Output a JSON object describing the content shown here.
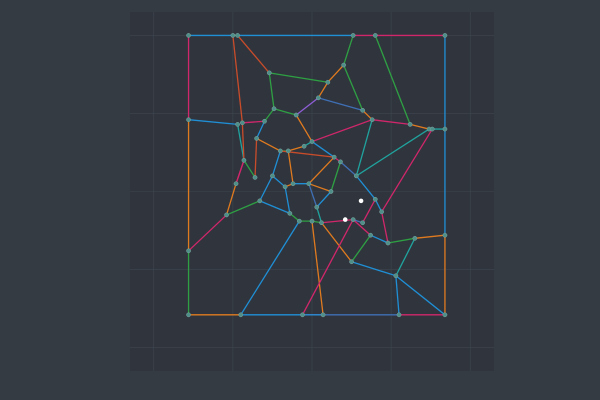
{
  "colors": {
    "figure_bg": "#353b43",
    "plot_bg": "#30353d",
    "grid": "#3f464f",
    "node_fill": "#4f8f8a",
    "node_stroke": "#7fa7a3",
    "highlight_node": "#ffffff",
    "palette": [
      "#1f8fd6",
      "#e07a1f",
      "#2ea043",
      "#d1266b",
      "#8e5ed6",
      "#20a39e",
      "#c94c2a",
      "#3f6fb5"
    ]
  },
  "chart_data": {
    "type": "scatter",
    "xlim": [
      -1.15,
      1.15
    ],
    "ylim": [
      -1.15,
      1.15
    ],
    "grid": true,
    "legend": "none",
    "nodes": [
      [
        -0.78,
        1.0
      ],
      [
        -0.5,
        1.0
      ],
      [
        -0.47,
        1.0
      ],
      [
        0.26,
        1.0
      ],
      [
        0.4,
        1.0
      ],
      [
        0.84,
        1.0
      ],
      [
        -0.78,
        0.46
      ],
      [
        -0.47,
        0.43
      ],
      [
        -0.44,
        0.44
      ],
      [
        -0.27,
        0.76
      ],
      [
        0.1,
        0.7
      ],
      [
        0.2,
        0.81
      ],
      [
        0.04,
        0.6
      ],
      [
        -0.24,
        0.53
      ],
      [
        -0.1,
        0.49
      ],
      [
        0.32,
        0.52
      ],
      [
        0.38,
        0.46
      ],
      [
        0.62,
        0.43
      ],
      [
        0.74,
        0.4
      ],
      [
        0.76,
        0.4
      ],
      [
        0.84,
        0.4
      ],
      [
        0.0,
        0.32
      ],
      [
        -0.3,
        0.45
      ],
      [
        -0.35,
        0.34
      ],
      [
        -0.2,
        0.26
      ],
      [
        -0.15,
        0.26
      ],
      [
        -0.05,
        0.29
      ],
      [
        -0.43,
        0.2
      ],
      [
        -0.48,
        0.05
      ],
      [
        -0.36,
        0.09
      ],
      [
        -0.25,
        0.1
      ],
      [
        -0.17,
        0.03
      ],
      [
        -0.12,
        0.05
      ],
      [
        -0.02,
        0.05
      ],
      [
        0.14,
        0.22
      ],
      [
        0.18,
        0.19
      ],
      [
        0.28,
        0.1
      ],
      [
        0.4,
        -0.05
      ],
      [
        0.44,
        -0.13
      ],
      [
        -0.54,
        -0.15
      ],
      [
        -0.78,
        -0.38
      ],
      [
        -0.33,
        -0.06
      ],
      [
        -0.14,
        -0.14
      ],
      [
        -0.08,
        -0.19
      ],
      [
        0.0,
        -0.19
      ],
      [
        0.06,
        -0.2
      ],
      [
        0.03,
        -0.1
      ],
      [
        0.12,
        0.0
      ],
      [
        0.32,
        -0.2
      ],
      [
        0.26,
        -0.18
      ],
      [
        0.48,
        -0.33
      ],
      [
        0.37,
        -0.28
      ],
      [
        0.65,
        -0.3
      ],
      [
        0.84,
        -0.28
      ],
      [
        0.25,
        -0.45
      ],
      [
        0.53,
        -0.54
      ],
      [
        0.84,
        -0.79
      ],
      [
        0.55,
        -0.79
      ],
      [
        0.07,
        -0.79
      ],
      [
        -0.06,
        -0.79
      ],
      [
        -0.45,
        -0.79
      ],
      [
        -0.78,
        -0.79
      ]
    ],
    "highlight_points": [
      [
        0.21,
        -0.18
      ],
      [
        0.31,
        -0.06
      ]
    ],
    "edges": [
      [
        0,
        1,
        0
      ],
      [
        0,
        6,
        3
      ],
      [
        1,
        2,
        2
      ],
      [
        2,
        3,
        0
      ],
      [
        3,
        4,
        3
      ],
      [
        4,
        5,
        3
      ],
      [
        5,
        20,
        0
      ],
      [
        6,
        40,
        1
      ],
      [
        6,
        7,
        0
      ],
      [
        1,
        8,
        6
      ],
      [
        2,
        9,
        6
      ],
      [
        9,
        10,
        2
      ],
      [
        3,
        11,
        2
      ],
      [
        11,
        10,
        1
      ],
      [
        10,
        12,
        1
      ],
      [
        12,
        14,
        4
      ],
      [
        9,
        13,
        2
      ],
      [
        13,
        14,
        2
      ],
      [
        11,
        15,
        2
      ],
      [
        12,
        15,
        7
      ],
      [
        15,
        16,
        1
      ],
      [
        4,
        17,
        2
      ],
      [
        16,
        17,
        3
      ],
      [
        17,
        18,
        1
      ],
      [
        18,
        19,
        5
      ],
      [
        19,
        20,
        5
      ],
      [
        16,
        21,
        3
      ],
      [
        14,
        21,
        1
      ],
      [
        8,
        22,
        3
      ],
      [
        22,
        13,
        2
      ],
      [
        22,
        23,
        0
      ],
      [
        23,
        24,
        1
      ],
      [
        24,
        25,
        2
      ],
      [
        25,
        26,
        1
      ],
      [
        26,
        21,
        5
      ],
      [
        7,
        27,
        5
      ],
      [
        8,
        27,
        6
      ],
      [
        27,
        28,
        3
      ],
      [
        23,
        29,
        6
      ],
      [
        29,
        27,
        2
      ],
      [
        24,
        30,
        0
      ],
      [
        30,
        31,
        0
      ],
      [
        31,
        32,
        1
      ],
      [
        32,
        25,
        1
      ],
      [
        32,
        33,
        0
      ],
      [
        33,
        34,
        1
      ],
      [
        21,
        34,
        0
      ],
      [
        34,
        35,
        3
      ],
      [
        35,
        36,
        7
      ],
      [
        18,
        36,
        5
      ],
      [
        36,
        37,
        0
      ],
      [
        37,
        38,
        0
      ],
      [
        19,
        38,
        3
      ],
      [
        28,
        39,
        1
      ],
      [
        39,
        40,
        3
      ],
      [
        30,
        41,
        0
      ],
      [
        41,
        39,
        2
      ],
      [
        41,
        42,
        0
      ],
      [
        31,
        42,
        0
      ],
      [
        42,
        43,
        2
      ],
      [
        43,
        44,
        2
      ],
      [
        44,
        45,
        2
      ],
      [
        45,
        46,
        5
      ],
      [
        46,
        47,
        0
      ],
      [
        47,
        33,
        1
      ],
      [
        47,
        35,
        2
      ],
      [
        33,
        46,
        7
      ],
      [
        37,
        48,
        3
      ],
      [
        48,
        49,
        7
      ],
      [
        49,
        45,
        3
      ],
      [
        20,
        53,
        0
      ],
      [
        53,
        52,
        1
      ],
      [
        52,
        50,
        2
      ],
      [
        50,
        38,
        3
      ],
      [
        50,
        51,
        0
      ],
      [
        51,
        49,
        3
      ],
      [
        51,
        54,
        2
      ],
      [
        54,
        45,
        1
      ],
      [
        52,
        55,
        5
      ],
      [
        55,
        54,
        0
      ],
      [
        56,
        55,
        0
      ],
      [
        53,
        56,
        1
      ],
      [
        56,
        57,
        3
      ],
      [
        57,
        59,
        7
      ],
      [
        59,
        58,
        3
      ],
      [
        58,
        60,
        0
      ],
      [
        60,
        61,
        1
      ],
      [
        61,
        40,
        2
      ],
      [
        57,
        55,
        0
      ],
      [
        58,
        44,
        1
      ],
      [
        59,
        49,
        3
      ],
      [
        60,
        43,
        0
      ],
      [
        28,
        27,
        3
      ],
      [
        36,
        16,
        5
      ],
      [
        34,
        24,
        6
      ]
    ]
  }
}
